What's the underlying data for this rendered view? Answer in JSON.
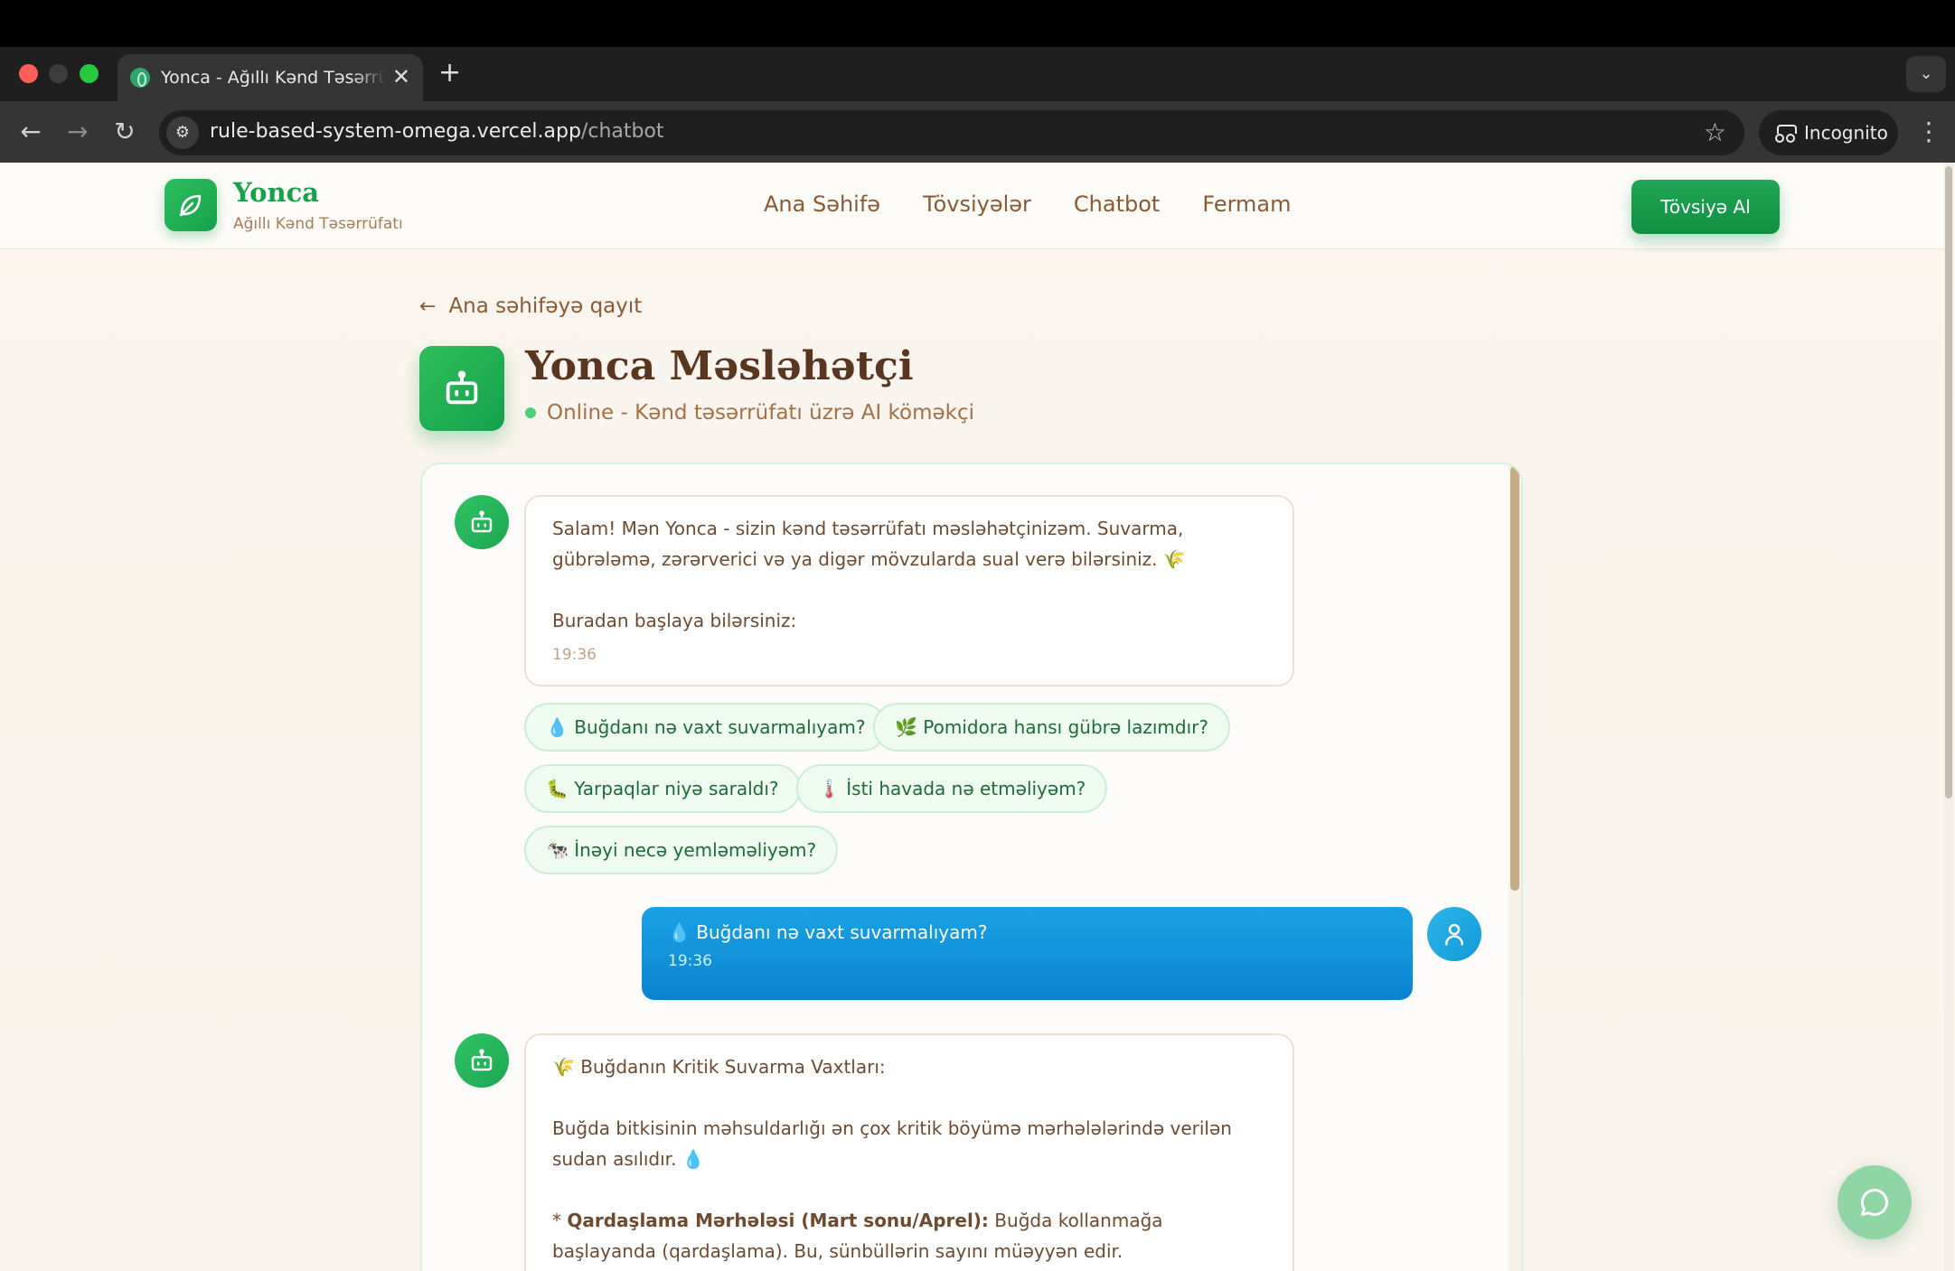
{
  "browser": {
    "tab_title": "Yonca - Ağıllı Kənd Təsərrüfatı",
    "tab_close": "✕",
    "new_tab": "+",
    "url_host": "rule-based-system-omega.vercel.app",
    "url_path": "/chatbot",
    "incognito_label": "Incognito",
    "icons": {
      "back": "←",
      "forward": "→",
      "reload": "↻",
      "tune": "⚙",
      "star": "☆",
      "menu": "⋮",
      "dropdown": "⌄"
    }
  },
  "header": {
    "brand_name": "Yonca",
    "brand_tagline": "Ağıllı Kənd Təsərrüfatı",
    "nav": [
      "Ana Səhifə",
      "Tövsiyələr",
      "Chatbot",
      "Fermam"
    ],
    "cta_label": "Tövsiyə Al"
  },
  "page": {
    "back_link": "Ana səhifəyə qayıt",
    "title": "Yonca Məsləhətçi",
    "status": "Online - Kənd təsərrüfatı üzrə AI köməkçi"
  },
  "chat": {
    "welcome": {
      "text": "Salam! Mən Yonca - sizin kənd təsərrüfatı məsləhətçinizəm. Suvarma, gübrələmə, zərərverici və ya digər mövzularda sual verə bilərsiniz. 🌾",
      "start_hint": "Buradan başlaya bilərsiniz:",
      "time": "19:36"
    },
    "suggestions": [
      "💧 Buğdanı nə vaxt suvarmalıyam?",
      "🌿 Pomidora hansı gübrə lazımdır?",
      "🐛 Yarpaqlar niyə saraldı?",
      "🌡️ İsti havada nə etməliyəm?",
      "🐄 İnəyi necə yemləməliyəm?"
    ],
    "user_message": {
      "text": "💧 Buğdanı nə vaxt suvarmalıyam?",
      "time": "19:36"
    },
    "bot_reply": {
      "heading": "🌾 Buğdanın Kritik Suvarma Vaxtları:",
      "intro": "Buğda bitkisinin məhsuldarlığı ən çox kritik böyümə mərhələlərində verilən sudan asılıdır. 💧",
      "bullet_prefix": "* ",
      "bullet_strong": "Qardaşlama Mərhələsi (Mart sonu/Aprel):",
      "bullet_text": " Buğda kollanmağa başlayanda (qardaşlama). Bu, sünbüllərin sayını müəyyən edir."
    }
  },
  "colors": {
    "brand_green": "#18a14b",
    "brown_text": "#8a5a34",
    "user_bubble": "#0a84cf"
  }
}
